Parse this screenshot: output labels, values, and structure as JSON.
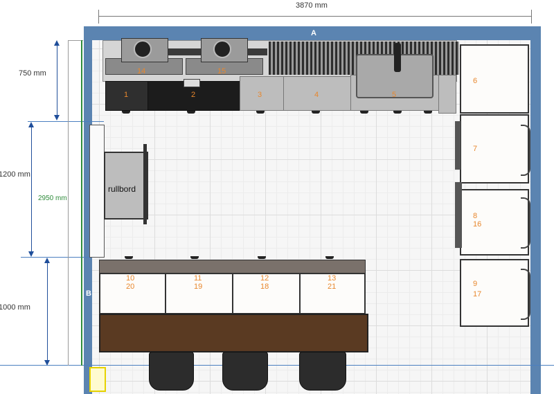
{
  "dimensions": {
    "width_top": "3870 mm",
    "depth_top": "750 mm",
    "gap_middle": "1200 mm",
    "depth_island": "1000 mm",
    "total_depth": "2950 mm"
  },
  "walls": {
    "top": "A",
    "left": "B"
  },
  "trolley_label": "rullbord",
  "top_row": [
    {
      "id": "1"
    },
    {
      "id": "2"
    },
    {
      "id": "3"
    },
    {
      "id": "4"
    },
    {
      "id": "5"
    }
  ],
  "hobs": [
    {
      "id": "14"
    },
    {
      "id": "15"
    }
  ],
  "right_column": [
    {
      "line1": "6",
      "line2": ""
    },
    {
      "line1": "7",
      "line2": ""
    },
    {
      "line1": "8",
      "line2": "16"
    },
    {
      "line1": "9",
      "line2": "17"
    }
  ],
  "island": [
    {
      "top": "10",
      "bottom": "20"
    },
    {
      "top": "11",
      "bottom": "19"
    },
    {
      "top": "12",
      "bottom": "18"
    },
    {
      "top": "13",
      "bottom": "21"
    }
  ],
  "colors": {
    "wall": "#5b84b1",
    "label_orange": "#e8872d",
    "dimension_blue": "#1f4e9a",
    "dimension_green": "#2e8b3a",
    "countertop_wood": "#5a3a22",
    "island_top": "#7a716b"
  }
}
